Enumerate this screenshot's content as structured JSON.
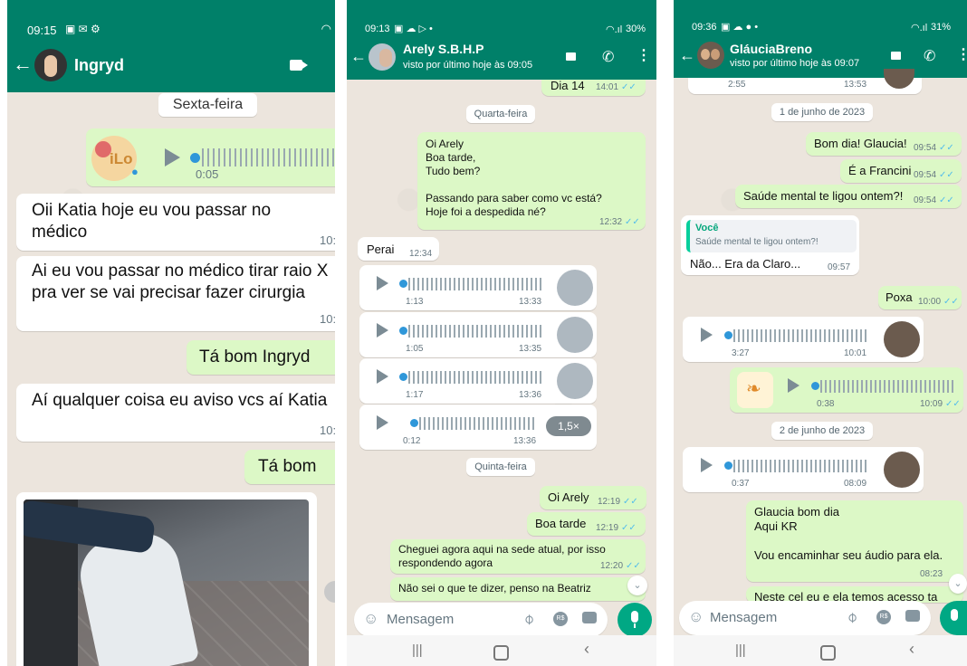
{
  "colors": {
    "header": "#008069",
    "incoming": "#ffffff",
    "outgoing": "#dcf8c6",
    "read_ticks": "#53bdeb",
    "accent": "#00a884"
  },
  "p1": {
    "status_time": "09:15",
    "contact_name": "Ingryd",
    "date_chip": "Sexta-feira",
    "audio_duration": "0:05",
    "audio_thumb_text": "iLo",
    "msgs": [
      {
        "text": "Oii Katia hoje eu vou passar no médico",
        "time": "10:"
      },
      {
        "text": "Ai eu vou passar no médico tirar raio X pra ver se vai precisar fazer cirurgia",
        "time": "10:"
      },
      {
        "text": "Tá bom Ingryd"
      },
      {
        "text": "Aí qualquer coisa eu aviso vcs aí Katia",
        "time": "10:"
      },
      {
        "text": "Tá bom"
      }
    ]
  },
  "p2": {
    "status_time": "09:13",
    "battery": "30%",
    "contact_name": "Arely S.B.H.P",
    "last_seen": "visto por último hoje às 09:05",
    "top_msg": {
      "text": "Dia 14",
      "time": "14:01"
    },
    "date1": "Quarta-feira",
    "long_msg": {
      "text": "Oi Arely\nBoa tarde,\nTudo bem?\n\nPassando para saber como vc está?\nHoje foi a despedida né?",
      "time": "12:32"
    },
    "perai": {
      "text": "Perai",
      "time": "12:34"
    },
    "audios": [
      {
        "dur": "1:13",
        "time": "13:33"
      },
      {
        "dur": "1:05",
        "time": "13:35"
      },
      {
        "dur": "1:17",
        "time": "13:36"
      },
      {
        "dur": "0:12",
        "time": "13:36",
        "speed": "1,5×"
      }
    ],
    "date2": "Quinta-feira",
    "out_msgs": [
      {
        "text": "Oi Arely",
        "time": "12:19"
      },
      {
        "text": "Boa tarde",
        "time": "12:19"
      },
      {
        "text": "Cheguei agora aqui na sede atual, por isso respondendo agora",
        "time": "12:20"
      }
    ],
    "partial_msg": "Não  sei o que te dizer, penso na Beatriz",
    "input_placeholder": "Mensagem"
  },
  "p3": {
    "status_time": "09:36",
    "battery": "31%",
    "contact_name": "GláuciaBreno",
    "last_seen": "visto por último hoje às 09:07",
    "top_audio": {
      "dur": "2:55",
      "time": "13:53"
    },
    "date1": "1 de junho de 2023",
    "out_msgs": [
      {
        "text": "Bom dia! Glaucia!",
        "time": "09:54"
      },
      {
        "text": "É a Francini",
        "time": "09:54"
      },
      {
        "text": "Saúde mental te ligou ontem?!",
        "time": "09:54"
      }
    ],
    "reply": {
      "author": "Você",
      "quoted": "Saúde mental te ligou ontem?!",
      "text": "Não... Era da Claro...",
      "time": "09:57"
    },
    "poxa": {
      "text": "Poxa",
      "time": "10:00"
    },
    "audio_in1": {
      "dur": "3:27",
      "time": "10:01"
    },
    "audio_out": {
      "dur": "0:38",
      "time": "10:09"
    },
    "date2": "2 de junho de 2023",
    "audio_in2": {
      "dur": "0:37",
      "time": "08:09"
    },
    "long_msg": {
      "text": "Glaucia bom dia\nAqui KR\n\nVou encaminhar seu áudio para ela.",
      "time": "08:23"
    },
    "partial_msg": "Neste cel eu e ela temos acesso ta",
    "input_placeholder": "Mensagem"
  }
}
